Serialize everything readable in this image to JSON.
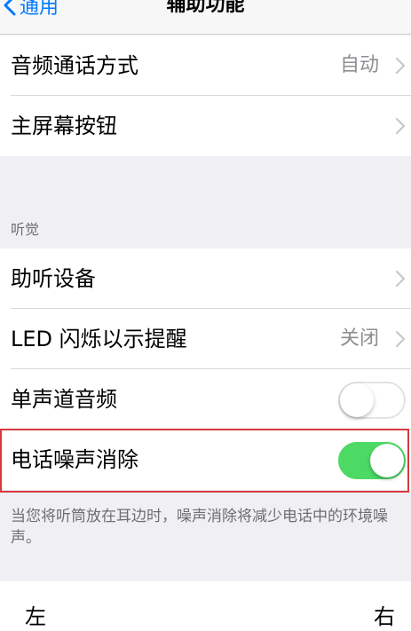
{
  "nav": {
    "back_label": "通用",
    "title": "辅助功能"
  },
  "group1": {
    "audio_routing": {
      "label": "音频通话方式",
      "value": "自动"
    },
    "home_button": {
      "label": "主屏幕按钮"
    }
  },
  "hearing": {
    "header": "听觉",
    "hearing_devices": {
      "label": "助听设备"
    },
    "led_flash": {
      "label": "LED 闪烁以示提醒",
      "value": "关闭"
    },
    "mono_audio": {
      "label": "单声道音频",
      "enabled": false
    },
    "noise_cancellation": {
      "label": "电话噪声消除",
      "enabled": true
    },
    "footer": "当您将听筒放在耳边时，噪声消除将减少电话中的环境噪声。"
  },
  "balance": {
    "left_label": "左",
    "right_label": "右"
  },
  "colors": {
    "accent": "#007aff",
    "toggle_on": "#4cd964",
    "highlight": "#d8393f"
  }
}
